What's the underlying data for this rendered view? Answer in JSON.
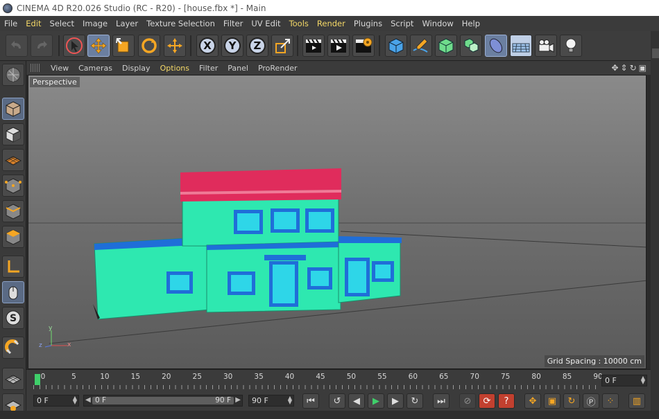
{
  "window": {
    "title": "CINEMA 4D R20.026 Studio (RC - R20) - [house.fbx *] - Main"
  },
  "menu": {
    "items": [
      {
        "label": "File",
        "hl": false
      },
      {
        "label": "Edit",
        "hl": true
      },
      {
        "label": "Select",
        "hl": false
      },
      {
        "label": "Image",
        "hl": false
      },
      {
        "label": "Layer",
        "hl": false
      },
      {
        "label": "Texture Selection",
        "hl": false
      },
      {
        "label": "Filter",
        "hl": false
      },
      {
        "label": "UV Edit",
        "hl": false
      },
      {
        "label": "Tools",
        "hl": true
      },
      {
        "label": "Render",
        "hl": true
      },
      {
        "label": "Plugins",
        "hl": false
      },
      {
        "label": "Script",
        "hl": false
      },
      {
        "label": "Window",
        "hl": false
      },
      {
        "label": "Help",
        "hl": false
      }
    ]
  },
  "toolbar": {
    "axis_x": "X",
    "axis_y": "Y",
    "axis_z": "Z"
  },
  "viewport_menu": {
    "view": "View",
    "cameras": "Cameras",
    "display": "Display",
    "options": "Options",
    "filter": "Filter",
    "panel": "Panel",
    "prorender": "ProRender"
  },
  "viewport": {
    "label": "Perspective",
    "grid_spacing": "Grid Spacing : 10000 cm",
    "axis_x": "x",
    "axis_y": "y",
    "axis_z": "z"
  },
  "timeline": {
    "ticks": [
      "0",
      "5",
      "10",
      "15",
      "20",
      "25",
      "30",
      "35",
      "40",
      "45",
      "50",
      "55",
      "60",
      "65",
      "70",
      "75",
      "80",
      "85",
      "90"
    ],
    "current_frame_field": "0 F"
  },
  "transport": {
    "start_field": "0 F",
    "range_start": "0 F",
    "range_end": "90 F",
    "end_field": "90 F"
  },
  "colors": {
    "house_body": "#2ee8b0",
    "roof_red": "#e02c5c",
    "window_blue": "#1f6ed8",
    "accent_menu": "#f4d867"
  }
}
